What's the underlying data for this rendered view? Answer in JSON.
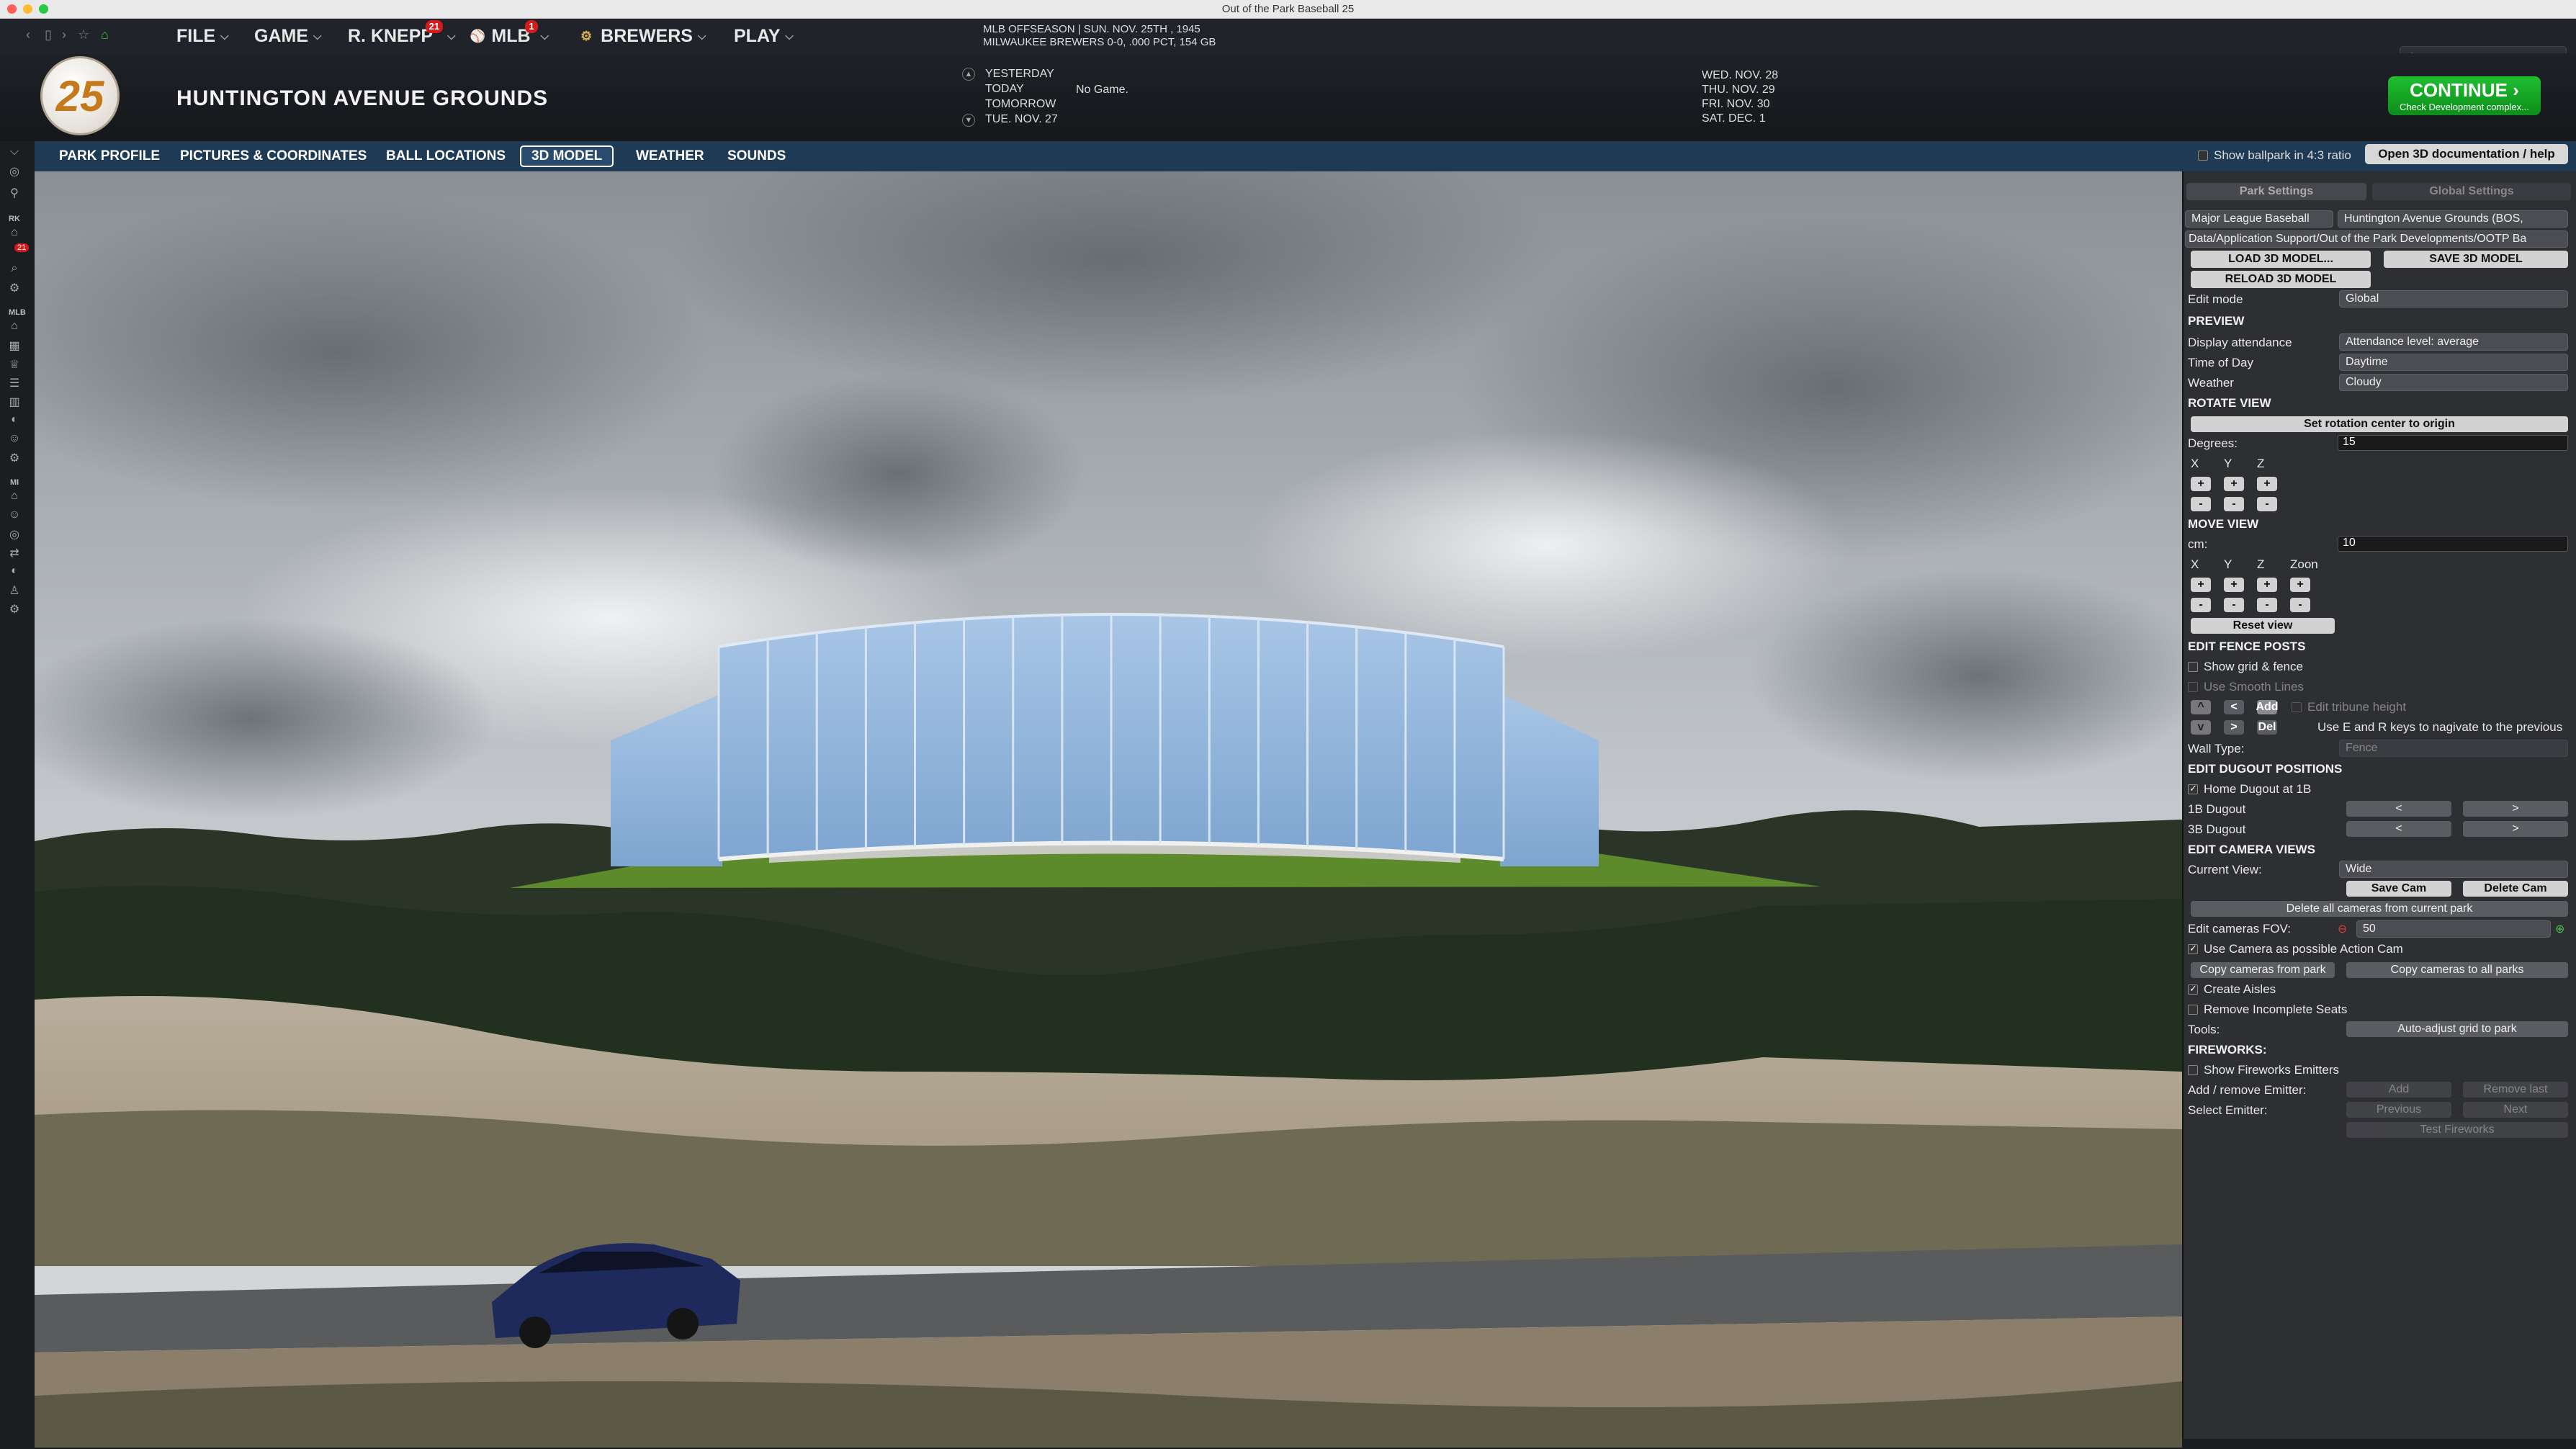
{
  "window_title": "Out of the Park Baseball 25",
  "nav": {
    "file": "FILE",
    "game": "GAME",
    "manager": "R. KNEPP",
    "manager_badge": "21",
    "league": "MLB",
    "league_badge": "1",
    "team": "BREWERS",
    "play": "PLAY"
  },
  "status": {
    "line1": "MLB OFFSEASON  |  SUN. NOV. 25TH , 1945",
    "line2": "MILWAUKEE BREWERS 0-0, .000 PCT, 154 GB"
  },
  "header": {
    "logo_text": "25",
    "park_title": "HUNTINGTON AVENUE GROUNDS",
    "days": [
      "YESTERDAY",
      "TODAY",
      "TOMORROW",
      "TUE. NOV. 27"
    ],
    "today_game": "No Game.",
    "upcoming": [
      "WED. NOV. 28",
      "THU. NOV. 29",
      "FRI. NOV. 30",
      "SAT. DEC. 1"
    ],
    "continue_label": "CONTINUE",
    "continue_sub": "Check Development complex..."
  },
  "tabs": [
    "PARK PROFILE",
    "PICTURES & COORDINATES",
    "BALL LOCATIONS",
    "3D MODEL",
    "WEATHER",
    "SOUNDS"
  ],
  "active_tab": "3D MODEL",
  "show_43_label": "Show ballpark in 4:3 ratio",
  "open_doc_label": "Open 3D documentation / help",
  "sidebar_tags": {
    "rk": "RK",
    "badge": "21",
    "mlb": "MLB",
    "mi": "MI"
  },
  "panel": {
    "tab_park": "Park Settings",
    "tab_global": "Global Settings",
    "league_select": "Major League Baseball",
    "park_select": "Huntington Avenue Grounds (BOS,",
    "path": "Data/Application Support/Out of the Park Developments/OOTP Ba",
    "load_model": "LOAD 3D MODEL...",
    "save_model": "SAVE 3D MODEL",
    "reload_model": "RELOAD 3D MODEL",
    "edit_mode_label": "Edit mode",
    "edit_mode_value": "Global",
    "preview": "PREVIEW",
    "attendance_label": "Display attendance",
    "attendance_value": "Attendance level: average",
    "time_label": "Time of Day",
    "time_value": "Daytime",
    "weather_label": "Weather",
    "weather_value": "Cloudy",
    "rotate_view": "ROTATE VIEW",
    "set_rotation": "Set rotation center to origin",
    "degrees_label": "Degrees:",
    "degrees_value": "15",
    "x": "X",
    "y": "Y",
    "z": "Z",
    "zoom": "Zoon",
    "plus": "+",
    "minus": "-",
    "move_view": "MOVE VIEW",
    "cm_label": "cm:",
    "cm_value": "10",
    "reset_view": "Reset view",
    "edit_fence": "EDIT FENCE POSTS",
    "show_grid": "Show grid & fence",
    "smooth_lines": "Use Smooth Lines",
    "arrow_up": "^",
    "arrow_left": "<",
    "add_short": "Add",
    "arrow_down": "v",
    "arrow_right": ">",
    "del_short": "Del",
    "edit_tribune": "Edit tribune height",
    "use_keys": "Use E and R keys to nagivate to the previous",
    "wall_type_label": "Wall Type:",
    "wall_type_value": "Fence",
    "edit_dugout": "EDIT DUGOUT POSITIONS",
    "home_dugout": "Home Dugout at 1B",
    "dugout_1b": "1B Dugout",
    "dugout_3b": "3B Dugout",
    "lt": "<",
    "gt": ">",
    "edit_cameras": "EDIT CAMERA VIEWS",
    "current_view_label": "Current View:",
    "current_view_value": "Wide",
    "save_cam": "Save Cam",
    "delete_cam": "Delete Cam",
    "delete_all": "Delete all cameras from current park",
    "fov_label": "Edit cameras FOV:",
    "fov_value": "50",
    "action_cam": "Use Camera as possible Action Cam",
    "copy_from": "Copy cameras from park",
    "copy_to": "Copy cameras to all parks",
    "create_aisles": "Create Aisles",
    "remove_seats": "Remove Incomplete Seats",
    "tools_label": "Tools:",
    "auto_adjust": "Auto-adjust grid to park",
    "fireworks": "FIREWORKS:",
    "show_fireworks": "Show Fireworks Emitters",
    "add_remove_label": "Add / remove Emitter:",
    "add": "Add",
    "remove_last": "Remove last",
    "select_emitter_label": "Select Emitter:",
    "previous": "Previous",
    "next": "Next",
    "test_fireworks": "Test Fireworks"
  }
}
